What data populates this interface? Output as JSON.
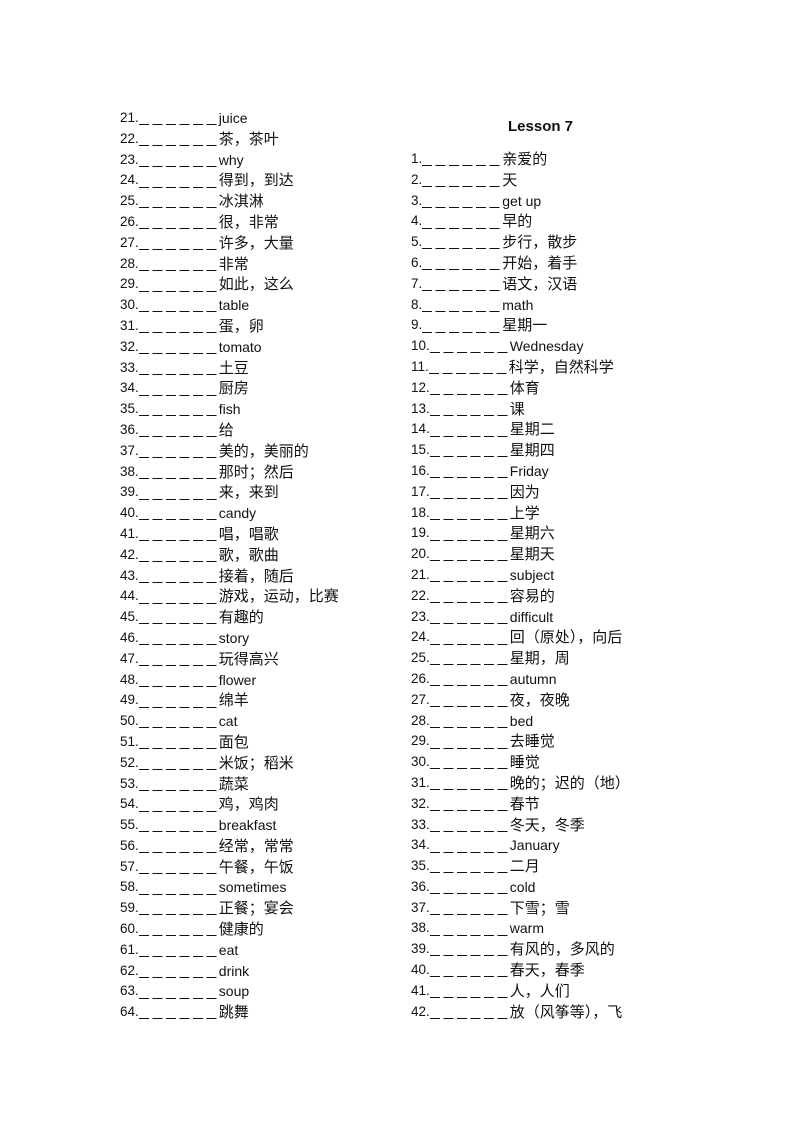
{
  "left_column": {
    "items": [
      {
        "num": "21.",
        "term": "juice"
      },
      {
        "num": "22.",
        "term": "茶，茶叶"
      },
      {
        "num": "23.",
        "term": "why"
      },
      {
        "num": "24.",
        "term": "得到，到达"
      },
      {
        "num": "25.",
        "term": "冰淇淋"
      },
      {
        "num": "26.",
        "term": "很，非常"
      },
      {
        "num": "27.",
        "term": "许多，大量"
      },
      {
        "num": "28.",
        "term": "非常"
      },
      {
        "num": "29.",
        "term": "如此，这么"
      },
      {
        "num": "30.",
        "term": "table"
      },
      {
        "num": "31.",
        "term": "蛋，卵"
      },
      {
        "num": "32.",
        "term": "tomato"
      },
      {
        "num": "33.",
        "term": "土豆"
      },
      {
        "num": "34.",
        "term": "厨房"
      },
      {
        "num": "35.",
        "term": "fish"
      },
      {
        "num": "36.",
        "term": "给"
      },
      {
        "num": "37.",
        "term": "美的，美丽的"
      },
      {
        "num": "38.",
        "term": "那时；然后"
      },
      {
        "num": "39.",
        "term": "来，来到"
      },
      {
        "num": "40.",
        "term": "candy"
      },
      {
        "num": "41.",
        "term": "唱，唱歌"
      },
      {
        "num": "42.",
        "term": "歌，歌曲"
      },
      {
        "num": "43.",
        "term": "接着，随后"
      },
      {
        "num": "44.",
        "term": "游戏，运动，比赛"
      },
      {
        "num": "45.",
        "term": "有趣的"
      },
      {
        "num": "46.",
        "term": "story"
      },
      {
        "num": "47.",
        "term": "玩得高兴"
      },
      {
        "num": "48.",
        "term": "flower"
      },
      {
        "num": "49.",
        "term": "绵羊"
      },
      {
        "num": "50.",
        "term": "cat"
      },
      {
        "num": "51.",
        "term": "面包"
      },
      {
        "num": "52.",
        "term": "米饭；稻米"
      },
      {
        "num": "53.",
        "term": "蔬菜"
      },
      {
        "num": "54.",
        "term": "鸡，鸡肉"
      },
      {
        "num": "55.",
        "term": "breakfast"
      },
      {
        "num": "56.",
        "term": "经常，常常"
      },
      {
        "num": "57.",
        "term": "午餐，午饭"
      },
      {
        "num": "58.",
        "term": "sometimes"
      },
      {
        "num": "59.",
        "term": "正餐；宴会"
      },
      {
        "num": "60.",
        "term": "健康的"
      },
      {
        "num": "61.",
        "term": "eat"
      },
      {
        "num": "62.",
        "term": "drink"
      },
      {
        "num": "63.",
        "term": "soup"
      },
      {
        "num": "64.",
        "term": "跳舞"
      }
    ]
  },
  "right_column": {
    "title": "Lesson 7",
    "items": [
      {
        "num": "1.",
        "term": "亲爱的"
      },
      {
        "num": "2.",
        "term": "天"
      },
      {
        "num": "3.",
        "term": "get up"
      },
      {
        "num": "4.",
        "term": "早的"
      },
      {
        "num": "5.",
        "term": "步行，散步"
      },
      {
        "num": "6.",
        "term": "开始，着手"
      },
      {
        "num": "7.",
        "term": "语文，汉语"
      },
      {
        "num": "8.",
        "term": "math"
      },
      {
        "num": "9.",
        "term": "星期一"
      },
      {
        "num": "10.",
        "term": "Wednesday"
      },
      {
        "num": "11.",
        "term": "科学，自然科学"
      },
      {
        "num": "12.",
        "term": "体育"
      },
      {
        "num": "13.",
        "term": "课"
      },
      {
        "num": "14.",
        "term": "星期二"
      },
      {
        "num": "15.",
        "term": "星期四"
      },
      {
        "num": "16.",
        "term": "Friday"
      },
      {
        "num": "17.",
        "term": "因为"
      },
      {
        "num": "18.",
        "term": "上学"
      },
      {
        "num": "19.",
        "term": "星期六"
      },
      {
        "num": "20.",
        "term": "星期天"
      },
      {
        "num": "21.",
        "term": "subject"
      },
      {
        "num": "22.",
        "term": "容易的"
      },
      {
        "num": "23.",
        "term": "difficult"
      },
      {
        "num": "24.",
        "term": "回（原处），向后"
      },
      {
        "num": "25.",
        "term": "星期，周"
      },
      {
        "num": "26.",
        "term": "autumn"
      },
      {
        "num": "27.",
        "term": "夜，夜晚"
      },
      {
        "num": "28.",
        "term": "bed"
      },
      {
        "num": "29.",
        "term": "去睡觉"
      },
      {
        "num": "30.",
        "term": "睡觉"
      },
      {
        "num": "31.",
        "term": "晚的；迟的（地）"
      },
      {
        "num": "32.",
        "term": "春节"
      },
      {
        "num": "33.",
        "term": "冬天，冬季"
      },
      {
        "num": "34.",
        "term": "January"
      },
      {
        "num": "35.",
        "term": "二月"
      },
      {
        "num": "36.",
        "term": "cold"
      },
      {
        "num": "37.",
        "term": "下雪；雪"
      },
      {
        "num": "38.",
        "term": "warm"
      },
      {
        "num": "39.",
        "term": "有风的，多风的"
      },
      {
        "num": "40.",
        "term": "春天，春季"
      },
      {
        "num": "41.",
        "term": "人，人们"
      },
      {
        "num": "42.",
        "term": "放（风筝等），飞"
      }
    ]
  }
}
